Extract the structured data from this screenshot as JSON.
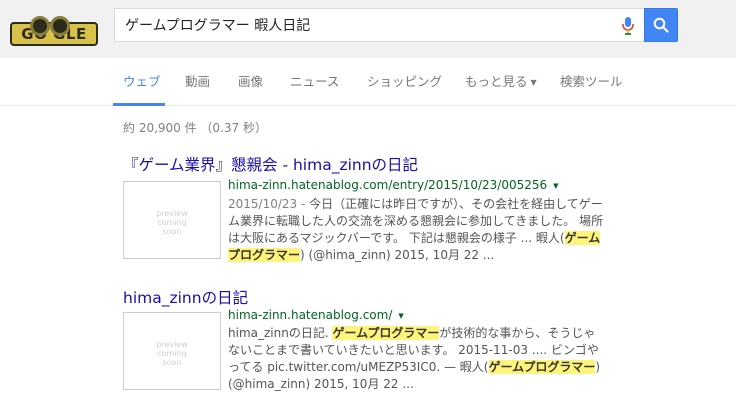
{
  "logo": {
    "text": "GO  GLE"
  },
  "search": {
    "query": "ゲームプログラマー 暇人日記"
  },
  "tabs": [
    {
      "label": "ウェブ"
    },
    {
      "label": "動画"
    },
    {
      "label": "画像"
    },
    {
      "label": "ニュース"
    },
    {
      "label": "ショッピング"
    },
    {
      "label": "もっと見る"
    },
    {
      "label": "検索ツール"
    }
  ],
  "stats": "約 20,900 件 （0.37 秒）",
  "thumbnail_text": {
    "line1": "preview",
    "line2": "coming",
    "line3": "soon"
  },
  "results": [
    {
      "title": "『ゲーム業界』懇親会 - hima_zinnの日記",
      "url": "hima-zinn.hatenablog.com/entry/2015/10/23/005256",
      "date": "2015/10/23 - ",
      "snippet_part1": "今日（正確には昨日ですが）、その会社を経由してゲーム業界に転職した人の交流を深める懇親会に参加してきました。 場所は大阪にあるマジックバーです。 下記は懇親会の様子 ... 暇人(",
      "highlight": "ゲームプログラマー",
      "snippet_part2": ") (@hima_zinn) 2015, 10月 22 ..."
    },
    {
      "title": "hima_zinnの日記",
      "url": "hima-zinn.hatenablog.com/",
      "snippet_part1": "hima_zinnの日記. ",
      "highlight": "ゲームプログラマー",
      "snippet_part2": "が技術的な事から、そうじゃないことまで書いていきたいと思います。 2015-11-03 .... ビンゴやってる pic.twitter.com/uMEZP53IC0. — 暇人(",
      "highlight2": "ゲームプログラマー",
      "snippet_part3": ") (@hima_zinn) 2015, 10月 22 ..."
    }
  ],
  "colors": {
    "accent": "#4285f4",
    "link": "#1a0dab",
    "url": "#006621",
    "highlight": "#fff47a"
  },
  "icons": {
    "mic": "mic-icon",
    "search": "search-icon",
    "caret": "caret-down-icon"
  }
}
